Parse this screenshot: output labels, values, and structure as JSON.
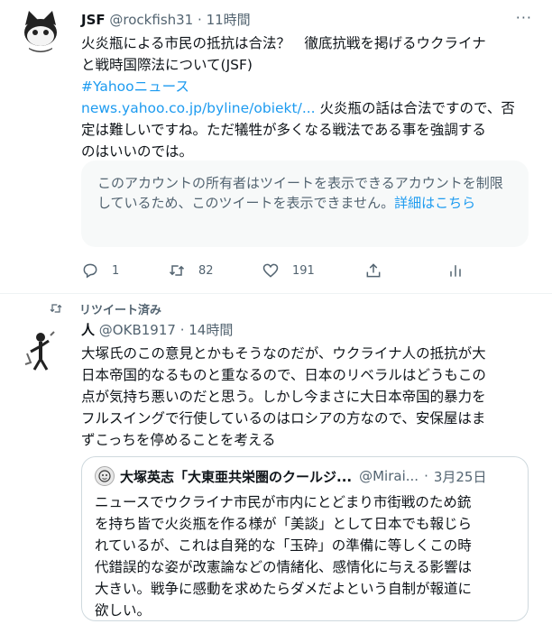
{
  "tweet1": {
    "display_name": "JSF",
    "handle": "@rockfish31",
    "separator": "·",
    "time": "11時間",
    "more": "···",
    "text_line1": "火炎瓶による市民の抵抗は合法？　徹底抗戦を掲げるウクライナ",
    "text_line2": "と戦時国際法について(JSF)",
    "hashtag": "#Yahooニュース",
    "link": "news.yahoo.co.jp/byline/obiekt/...",
    "text_after_link": " 火炎瓶の話は合法ですので、否",
    "text_line5": "定は難しいですね。ただ犠牲が多くなる戦法である事を強調する",
    "text_line6": "のはいいのでは。",
    "notice_text": "このアカウントの所有者はツイートを表示できるアカウントを制限しているため、このツイートを表示できません。",
    "notice_link": "詳細はこちら",
    "reply_count": "1",
    "retweet_count": "82",
    "like_count": "191"
  },
  "retweet_label": "リツイート済み",
  "tweet2": {
    "display_name": "人",
    "handle": "@OKB1917",
    "separator": "·",
    "time": "14時間",
    "text_line1": "大塚氏のこの意見とかもそうなのだが、ウクライナ人の抵抗が大",
    "text_line2": "日本帝国的なるものと重なるので、日本のリベラルはどうもこの",
    "text_line3": "点が気持ち悪いのだと思う。しかし今まさに大日本帝国的暴力を",
    "text_line4": "フルスイングで行使しているのはロシアの方なので、安保屋はま",
    "text_line5": "ずこっちを停めることを考える"
  },
  "quote": {
    "display_name": "大塚英志「大東亜共栄圏のクールジ...",
    "handle": "@Mirai...",
    "separator": "·",
    "date": "3月25日",
    "text_line1": "ニュースでウクライナ市民が市内にとどまり市街戦のため銃",
    "text_line2": "を持ち皆で火炎瓶を作る様が「美談」として日本でも報じら",
    "text_line3": "れているが、これは自発的な「玉砕」の準備に等しくこの時",
    "text_line4": "代錯誤的な姿が改憲論などの情緒化、感情化に与える影響は",
    "text_line5": "大きい。戦争に感動を求めたらダメだよという自制が報道に",
    "text_line6": "欲しい。"
  },
  "colors": {
    "link": "#1d9bf0",
    "secondary_text": "#536471",
    "notice_background": "#f7f9f9"
  }
}
